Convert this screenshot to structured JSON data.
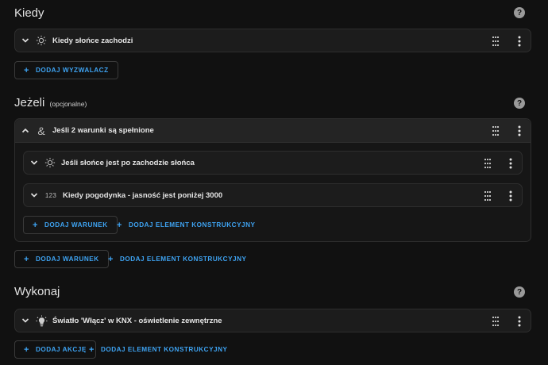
{
  "help_glyph": "?",
  "sections": {
    "kiedy": {
      "title": "Kiedy",
      "trigger": {
        "label": "Kiedy słońce zachodzi",
        "icon": "sun-icon"
      },
      "add_label": "DODAJ WYZWALACZ"
    },
    "jezeli": {
      "title": "Jeżeli",
      "optional": "(opcjonalne)",
      "group": {
        "label": "Jeśli 2 warunki są spełnione",
        "icon": "ampersand-icon",
        "conditions": [
          {
            "label": "Jeśli słońce jest po zachodzie słońca",
            "icon": "sun-icon"
          },
          {
            "label": "Kiedy pogodynka - jasność jest poniżej 3000",
            "icon": "numeric-icon",
            "icon_text": "123"
          }
        ],
        "add_condition_label": "DODAJ WARUNEK",
        "add_block_label": "DODAJ ELEMENT KONSTRUKCYJNY"
      },
      "add_condition_label": "DODAJ WARUNEK",
      "add_block_label": "DODAJ ELEMENT KONSTRUKCYJNY"
    },
    "wykonaj": {
      "title": "Wykonaj",
      "action": {
        "label": "Światło 'Włącz' w KNX - oświetlenie zewnętrzne",
        "icon": "lightbulb-icon"
      },
      "add_action_label": "DODAJ AKCJĘ",
      "add_block_label": "DODAJ ELEMENT KONSTRUKCYJNY"
    }
  },
  "plus_glyph": "+",
  "colors": {
    "background": "#111111",
    "card": "#1c1c1c",
    "accent": "#3ea3f2"
  }
}
